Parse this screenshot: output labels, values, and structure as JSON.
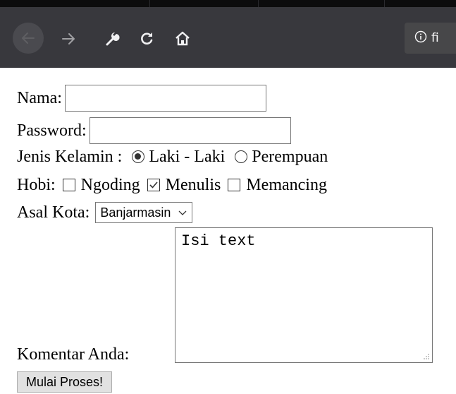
{
  "browser": {
    "url_text": "fi",
    "icons": [
      "back-arrow-icon",
      "forward-arrow-icon",
      "wrench-icon",
      "reload-icon",
      "home-icon",
      "info-icon"
    ],
    "colors": {
      "toolbar": "#38383d",
      "topstrip": "#0c0c0d",
      "urlbar": "#474749"
    }
  },
  "form": {
    "nama_label": "Nama:",
    "password_label": "Password:",
    "gender_label": "Jenis Kelamin :",
    "gender_options": [
      {
        "label": "Laki - Laki",
        "checked": true
      },
      {
        "label": "Perempuan",
        "checked": false
      }
    ],
    "hobby_label": "Hobi:",
    "hobby_options": [
      {
        "label": "Ngoding",
        "checked": false
      },
      {
        "label": "Menulis",
        "checked": true
      },
      {
        "label": "Memancing",
        "checked": false
      }
    ],
    "city_label": "Asal Kota:",
    "city_selected": "Banjarmasin",
    "comment_label": "Komentar Anda:",
    "comment_value": "Isi text",
    "submit_label": "Mulai Proses!"
  }
}
